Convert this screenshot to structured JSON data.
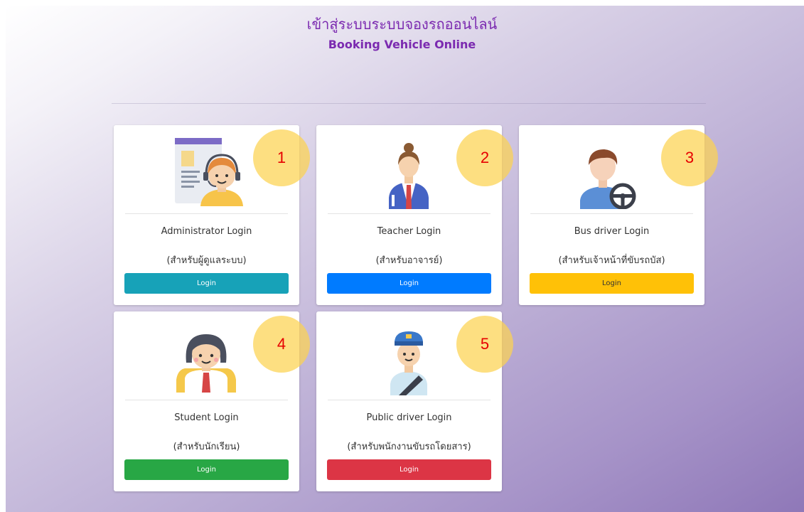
{
  "header": {
    "title_th": "เข้าสู่ระบบระบบจองรถออนไลน์",
    "title_en": "Booking Vehicle Online"
  },
  "cards": [
    {
      "name": "Administrator Login",
      "subtitle": "(สำหรับผู้ดูแลระบบ)",
      "button": "Login",
      "icon": "admin-support-icon",
      "button_color": "#17a2b8",
      "badge": "1"
    },
    {
      "name": "Teacher Login",
      "subtitle": "(สำหรับอาจารย์)",
      "button": "Login",
      "icon": "teacher-icon",
      "button_color": "#007bff",
      "badge": "2"
    },
    {
      "name": "Bus driver Login",
      "subtitle": "(สำหรับเจ้าหน้าที่ขับรถบัส)",
      "button": "Login",
      "icon": "bus-driver-icon",
      "button_color": "#ffc107",
      "badge": "3"
    },
    {
      "name": "Student Login",
      "subtitle": "(สำหรับนักเรียน)",
      "button": "Login",
      "icon": "student-icon",
      "button_color": "#28a745",
      "badge": "4"
    },
    {
      "name": "Public driver Login",
      "subtitle": "(สำหรับพนักงานขับรถโดยสาร)",
      "button": "Login",
      "icon": "public-driver-icon",
      "button_color": "#dc3545",
      "badge": "5"
    }
  ],
  "colors": {
    "title": "#7b2ab0",
    "badge_fill": "#fcd250",
    "badge_text": "#e60000"
  }
}
